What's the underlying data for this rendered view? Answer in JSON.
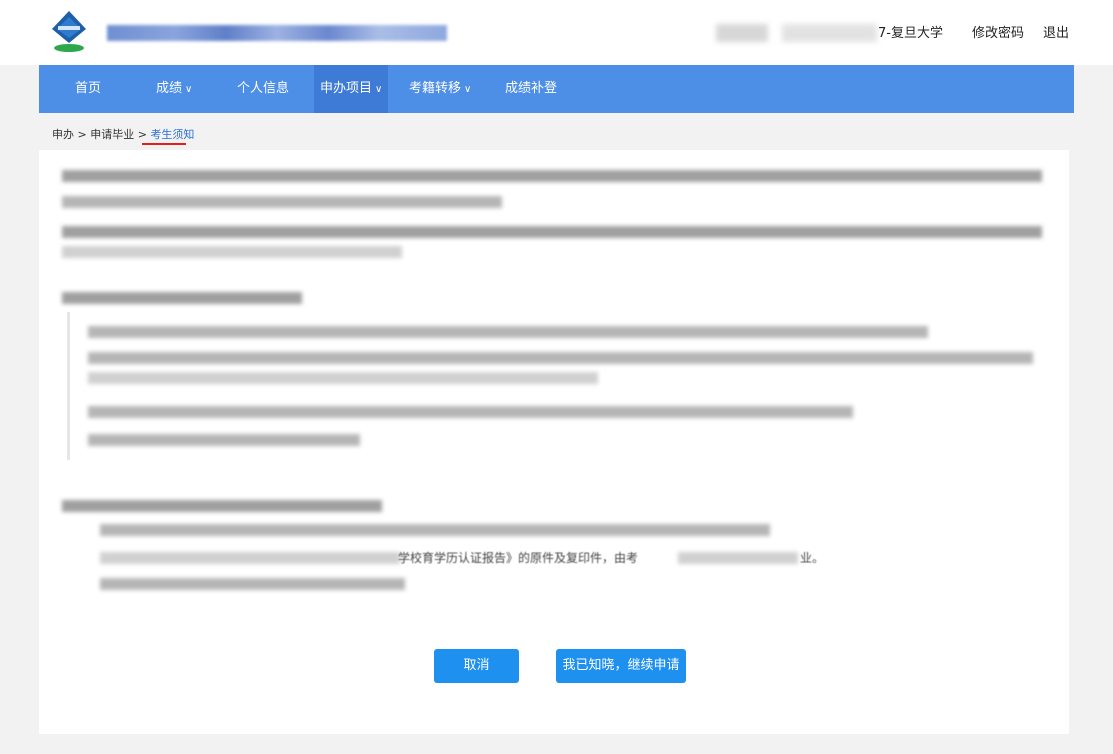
{
  "header": {
    "school": "7-复旦大学",
    "change_password": "修改密码",
    "logout": "退出"
  },
  "nav": {
    "items": [
      {
        "label": "首页"
      },
      {
        "label": "成绩"
      },
      {
        "label": "个人信息"
      },
      {
        "label": "申办项目"
      },
      {
        "label": "考籍转移"
      },
      {
        "label": "成绩补登"
      }
    ]
  },
  "breadcrumb": {
    "part1": "申办",
    "sep": ">",
    "part2": "申请毕业",
    "current": "考生须知"
  },
  "content": {
    "fragment_1": "学校育学历认证报告》的原件及复印件，由考",
    "fragment_2": "业。"
  },
  "buttons": {
    "cancel": "取消",
    "continue": "我已知晓，继续申请"
  },
  "colors": {
    "nav_bg": "#4d8ee6",
    "nav_active": "#3d7bd6",
    "button_bg": "#1e90f0",
    "breadcrumb_current": "#2c6fd6",
    "underline": "#e02020"
  },
  "icons": {
    "logo": "exam-authority-logo",
    "dropdown": "chevron-down-icon"
  }
}
